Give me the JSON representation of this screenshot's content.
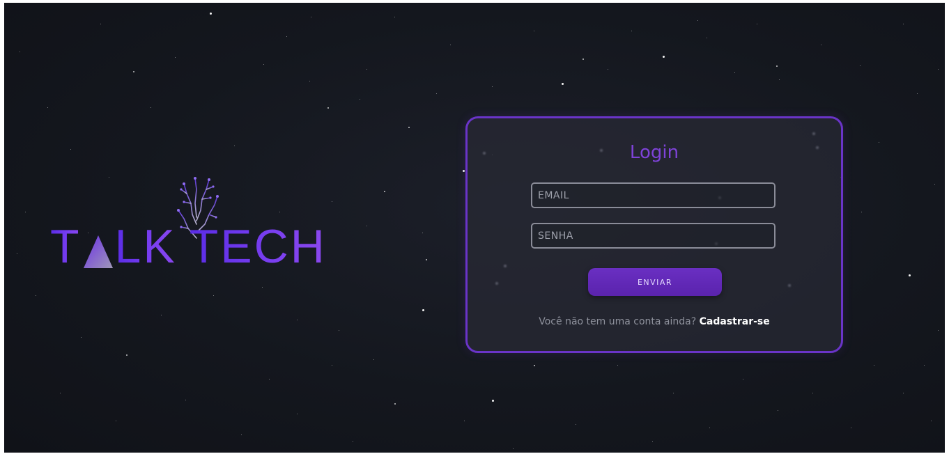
{
  "brand": {
    "name_part1": "T",
    "name_part2": "LK",
    "name_part3": "TECH",
    "colors": {
      "primary": "#6b2fe8",
      "accent": "#7e43d8",
      "button": "#5f27b5",
      "border": "#6a34c8",
      "background": "#14171e"
    }
  },
  "login": {
    "title": "Login",
    "email_placeholder": "EMAIL",
    "password_placeholder": "SENHA",
    "submit_label": "ENVIAR",
    "signup_prompt": "Você não tem uma conta ainda?",
    "signup_link": "Cadastrar-se"
  },
  "icons": {
    "logo_triangle": "triangle-icon",
    "logo_tree": "circuit-tree-icon"
  }
}
